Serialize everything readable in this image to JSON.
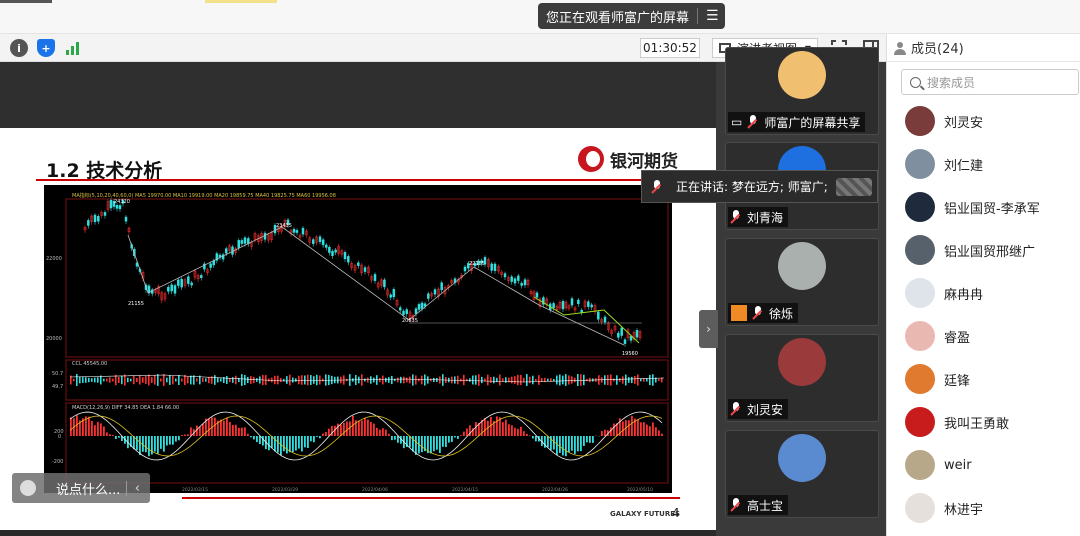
{
  "banner": {
    "text": "您正在观看师富广的屏幕",
    "menu_icon": "menu-icon"
  },
  "toolbar": {
    "timer": "01:30:52",
    "view_label": "演讲者视图"
  },
  "members": {
    "header": "成员(24)",
    "search_placeholder": "搜索成员",
    "list": [
      {
        "name": "刘灵安",
        "color": "#7a3b3b"
      },
      {
        "name": "刘仁建",
        "color": "#7f8fa0"
      },
      {
        "name": "铝业国贸-李承军",
        "color": "#1f2a3d"
      },
      {
        "name": "铝业国贸邢继广",
        "color": "#56616b"
      },
      {
        "name": "麻冉冉",
        "color": "#dfe3ea"
      },
      {
        "name": "睿盈",
        "color": "#e9b8b0"
      },
      {
        "name": "廷锋",
        "color": "#e07a2e"
      },
      {
        "name": "我叫王勇敢",
        "color": "#c81b1b"
      },
      {
        "name": "weir",
        "color": "#b8a88a"
      },
      {
        "name": "林进宇",
        "color": "#e6e0dc"
      }
    ]
  },
  "speakers": {
    "tiles": [
      {
        "name": "师富广的屏幕共享",
        "color": "#f0c070"
      },
      {
        "name": "刘青海",
        "color": "#1e6fe0"
      },
      {
        "name": "徐烁",
        "color": "#a9b0ae"
      },
      {
        "name": "刘灵安",
        "color": "#9a3a3a"
      },
      {
        "name": "高士宝",
        "color": "#5a8bd0"
      }
    ]
  },
  "talking": {
    "text": "正在讲话: 梦在远方; 师富广;"
  },
  "slide": {
    "title": "1.2 技术分析",
    "logo_text": "银河期货",
    "footer_brand": "GALAXY FUTURES",
    "page": "4"
  },
  "chart_data": {
    "type": "candlestick",
    "ma_header": "MA指标(5,10,20,40,60,0)  MA5 19970.00  MA10 19919.00  MA20 19859.75  MA40 19825.75  MA60 19956.08",
    "y_ticks": [
      "22000",
      "20000"
    ],
    "annotations": [
      "24320",
      "21155",
      "23435",
      "20635",
      "22185",
      "19560"
    ],
    "x_labels": [
      "2022/03/15",
      "2022/03/29",
      "2022/04/06",
      "2022/04/15",
      "2022/04/26",
      "2022/05/10"
    ],
    "volume_header": "CCL    45545.00",
    "volume_ticks": [
      "50.7",
      "49.7"
    ],
    "macd_header": "MACD(12,26,9)  DIFF 34.85  DEA 1.84  66.00",
    "macd_ticks": [
      "200",
      "0",
      "-200"
    ]
  },
  "chat": {
    "placeholder": "说点什么..."
  }
}
